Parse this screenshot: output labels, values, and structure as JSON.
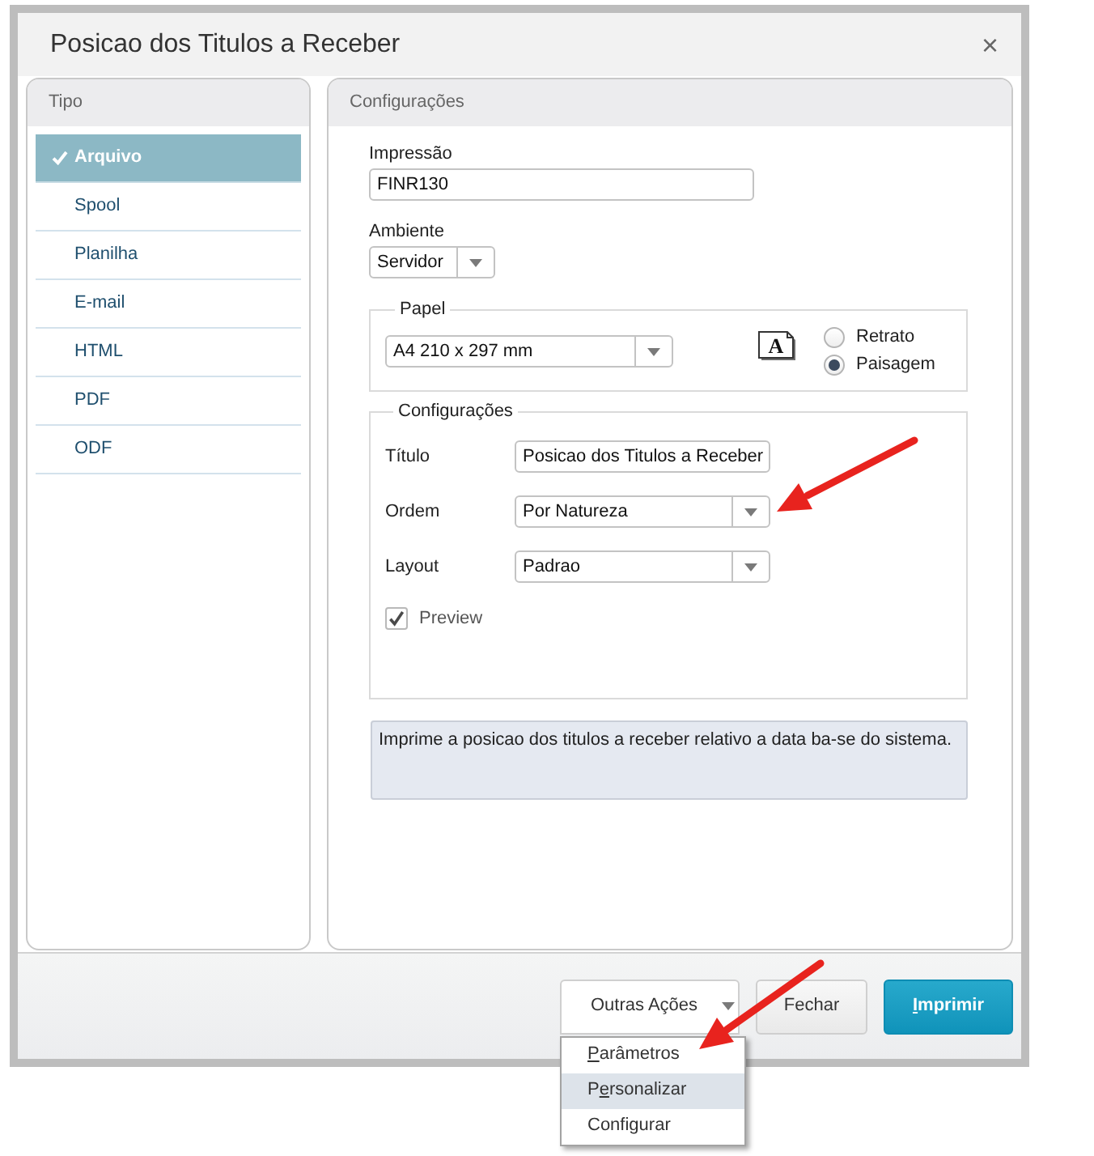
{
  "window": {
    "title": "Posicao dos Titulos a Receber",
    "close": "×"
  },
  "tipo_panel": {
    "title": "Tipo",
    "items": [
      {
        "label": "Arquivo",
        "selected": true
      },
      {
        "label": "Spool",
        "selected": false
      },
      {
        "label": "Planilha",
        "selected": false
      },
      {
        "label": "E-mail",
        "selected": false
      },
      {
        "label": "HTML",
        "selected": false
      },
      {
        "label": "PDF",
        "selected": false
      },
      {
        "label": "ODF",
        "selected": false
      }
    ]
  },
  "config_panel": {
    "title": "Configurações",
    "impressao": {
      "label": "Impressão",
      "value": "FINR130"
    },
    "ambiente": {
      "label": "Ambiente",
      "value": "Servidor"
    },
    "papel": {
      "legend": "Papel",
      "paper_size": "A4 210 x 297 mm",
      "orientation_icon_text": "A",
      "orientation": [
        {
          "label": "Retrato",
          "selected": false
        },
        {
          "label": "Paisagem",
          "selected": true
        }
      ]
    },
    "configuracoes": {
      "legend": "Configurações",
      "fields": [
        {
          "kind": "text",
          "label": "Título",
          "value": "Posicao dos Titulos a Receber"
        },
        {
          "kind": "select",
          "label": "Ordem",
          "value": "Por Natureza"
        },
        {
          "kind": "select",
          "label": "Layout",
          "value": "Padrao"
        }
      ],
      "preview": {
        "label": "Preview",
        "checked": true
      }
    },
    "description": "Imprime a posicao dos titulos a receber relativo a data ba-se do sistema."
  },
  "buttons": [
    {
      "kind": "menu",
      "label": "Outras Ações",
      "expanded": true,
      "menu": {
        "items": [
          {
            "label": "Parâmetros",
            "first_letter_underlined": true,
            "selected": false
          },
          {
            "label": "Personalizar",
            "second_letter_underlined": true,
            "selected": true
          },
          {
            "label": "Configurar",
            "selected": false
          }
        ]
      }
    },
    {
      "kind": "secondary",
      "label": "Fechar"
    },
    {
      "kind": "primary",
      "label": "Imprimir",
      "first_letter_underlined": true
    }
  ]
}
